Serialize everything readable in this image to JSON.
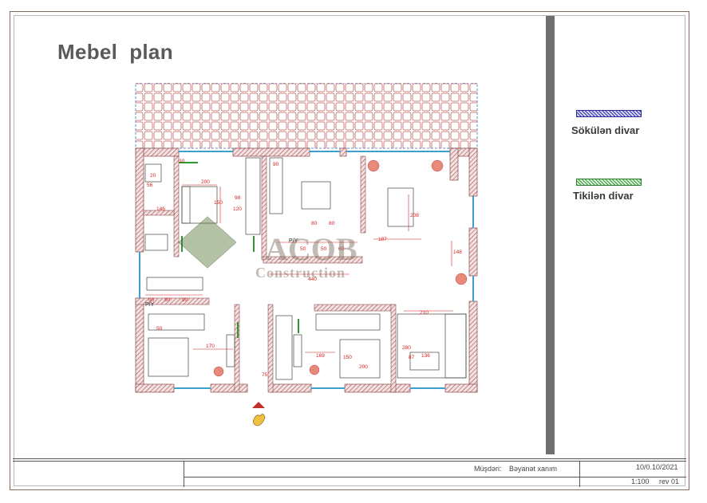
{
  "document": {
    "title": "Mebel  plan"
  },
  "legend": {
    "removed_wall": {
      "label": "Sökülən divar",
      "color": "#3030b0"
    },
    "built_wall": {
      "label": "Tikilən divar",
      "color": "#3a9a3a"
    }
  },
  "watermark": {
    "brand": "ACOB",
    "sub": "Construction"
  },
  "plan_labels": {
    "dims": [
      "200",
      "150",
      "98",
      "120",
      "80",
      "80",
      "50",
      "50",
      "60",
      "187",
      "208",
      "148",
      "440",
      "50",
      "50",
      "90",
      "50",
      "170",
      "169",
      "200",
      "150",
      "210",
      "136",
      "87",
      "280",
      "75",
      "20",
      "90",
      "30",
      "146",
      "56"
    ],
    "tags": [
      "P/Y",
      "P/Y"
    ]
  },
  "title_block": {
    "client_label": "Müşdəri:",
    "client_value": "Bəyanət xanım",
    "date": "10/0.10/2021",
    "scale": "1:100",
    "revision": "rev 01"
  },
  "colors": {
    "wall_hatch": "#a84848",
    "dimension": "#d42020",
    "window": "#3aa0d0"
  }
}
